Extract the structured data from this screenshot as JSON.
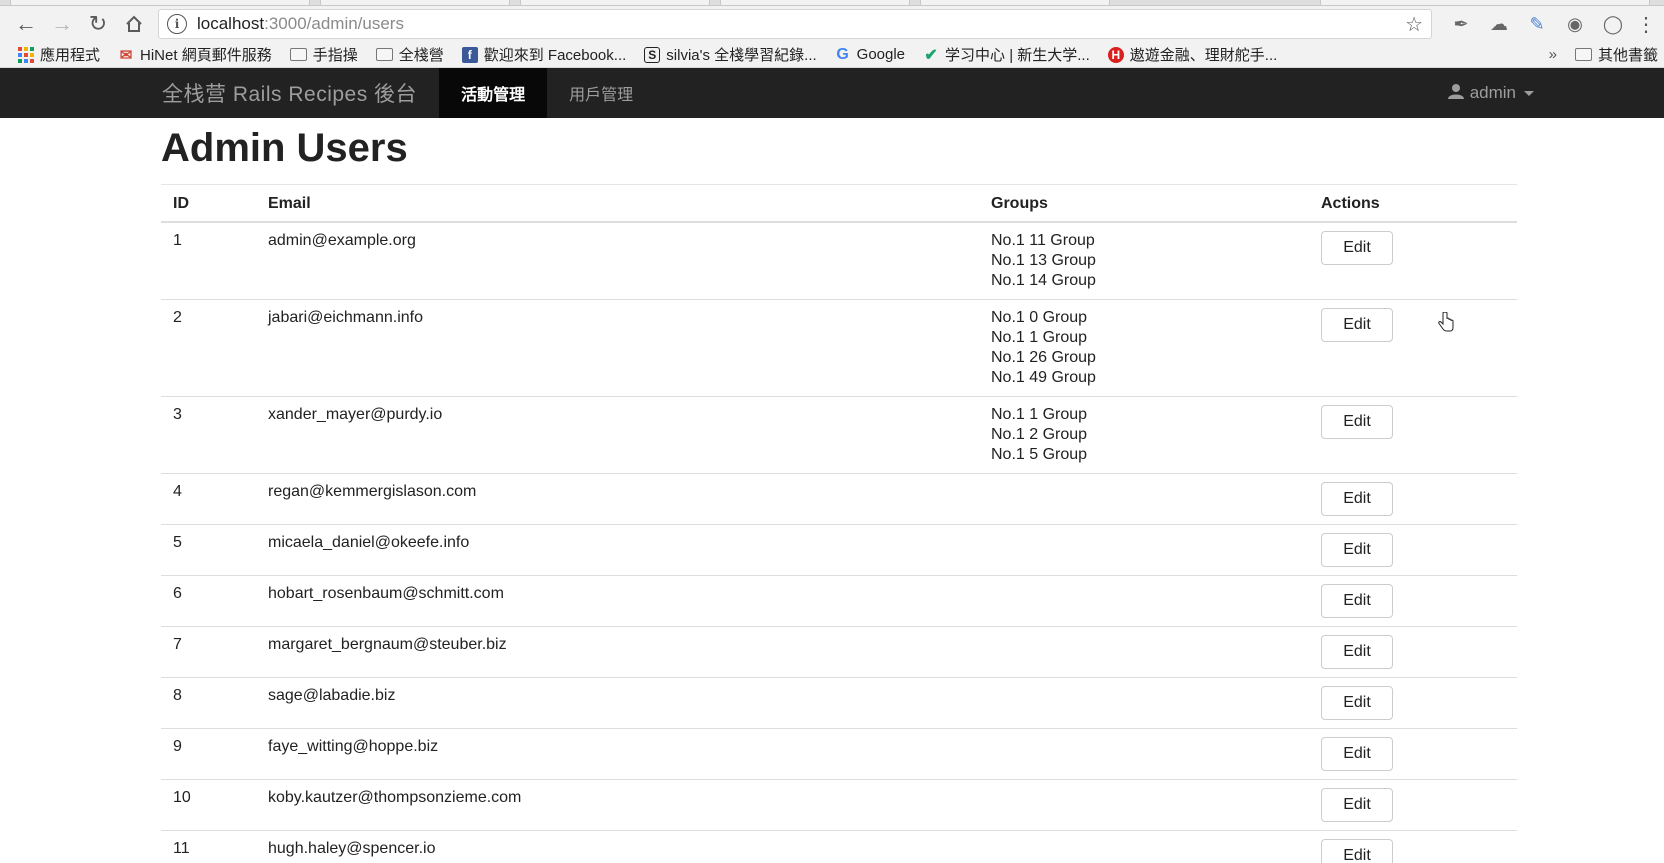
{
  "browser": {
    "url_host": "localhost",
    "url_path": ":3000/admin/users",
    "bookmarks": [
      {
        "label": "應用程式",
        "icon": "apps-icon"
      },
      {
        "label": "HiNet 網頁郵件服務",
        "icon": "mail-icon"
      },
      {
        "label": "手指操",
        "icon": "folder-icon"
      },
      {
        "label": "全棧營",
        "icon": "folder-icon"
      },
      {
        "label": "歡迎來到 Facebook...",
        "icon": "facebook-icon"
      },
      {
        "label": "silvia's 全棧學習紀錄...",
        "icon": "silvia-icon"
      },
      {
        "label": "Google",
        "icon": "google-icon"
      },
      {
        "label": "学习中心 | 新生大学...",
        "icon": "study-icon"
      },
      {
        "label": "遨遊金融、理財舵手...",
        "icon": "finance-icon"
      }
    ],
    "bookmarks_more": "»",
    "bookmarks_other": "其他書籤"
  },
  "navbar": {
    "brand": "全栈营 Rails Recipes 後台",
    "items": [
      {
        "label": "活動管理",
        "active": true
      },
      {
        "label": "用戶管理",
        "active": false
      }
    ],
    "user": "admin"
  },
  "page": {
    "title": "Admin Users"
  },
  "table": {
    "headers": {
      "id": "ID",
      "email": "Email",
      "groups": "Groups",
      "actions": "Actions"
    },
    "edit_label": "Edit",
    "rows": [
      {
        "id": "1",
        "email": "admin@example.org",
        "groups": [
          "No.1 11 Group",
          "No.1 13 Group",
          "No.1 14 Group"
        ]
      },
      {
        "id": "2",
        "email": "jabari@eichmann.info",
        "groups": [
          "No.1 0 Group",
          "No.1 1 Group",
          "No.1 26 Group",
          "No.1 49 Group"
        ]
      },
      {
        "id": "3",
        "email": "xander_mayer@purdy.io",
        "groups": [
          "No.1 1 Group",
          "No.1 2 Group",
          "No.1 5 Group"
        ]
      },
      {
        "id": "4",
        "email": "regan@kemmergislason.com",
        "groups": []
      },
      {
        "id": "5",
        "email": "micaela_daniel@okeefe.info",
        "groups": []
      },
      {
        "id": "6",
        "email": "hobart_rosenbaum@schmitt.com",
        "groups": []
      },
      {
        "id": "7",
        "email": "margaret_bergnaum@steuber.biz",
        "groups": []
      },
      {
        "id": "8",
        "email": "sage@labadie.biz",
        "groups": []
      },
      {
        "id": "9",
        "email": "faye_witting@hoppe.biz",
        "groups": []
      },
      {
        "id": "10",
        "email": "koby.kautzer@thompsonzieme.com",
        "groups": []
      },
      {
        "id": "11",
        "email": "hugh.haley@spencer.io",
        "groups": []
      }
    ]
  }
}
